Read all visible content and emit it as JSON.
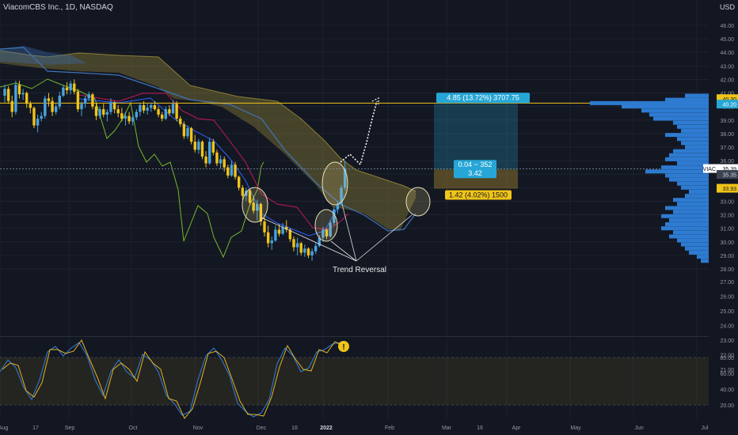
{
  "header": {
    "title": "ViacomCBS Inc., 1D, NASDAQ",
    "currency": "USD"
  },
  "chart_data": {
    "type": "candlestick",
    "price_axis": {
      "ticks": [
        28.0,
        29.0,
        30.0,
        31.0,
        32.0,
        33.0,
        34.0,
        35.0,
        36.0,
        37.0,
        38.0,
        39.0,
        40.0,
        41.0,
        42.0,
        43.0,
        44.0,
        45.0,
        46.0
      ],
      "min": 27.5,
      "max": 46.5
    },
    "extended_ticks": [
      "27.00",
      "26.00",
      "25.00",
      "24.00",
      "23.00",
      "22.00",
      "21.00"
    ],
    "oscillator_axis": {
      "ticks": [
        "20.00",
        "40.00",
        "60.00",
        "80.00"
      ],
      "band": [
        20,
        80
      ]
    },
    "time_axis": [
      "Aug",
      "17",
      "Sep",
      "Oct",
      "Nov",
      "Dec",
      "16",
      "2022",
      "Feb",
      "Mar",
      "16",
      "Apr",
      "May",
      "Jun",
      "Jul"
    ],
    "price_labels": {
      "last": "35.39",
      "symbol": "VIAC",
      "level_top_a": "40.30",
      "level_top_b": "40.20",
      "level_mid": "35.35",
      "level_stop": "33.93"
    },
    "position_tool": {
      "target_label": "4.85 (13.72%) 3707.75",
      "center_line1": "0.04 ~ 352",
      "center_line2": "3.42",
      "stop_label": "1.42 (4.02%) 1500",
      "entry": 35.35,
      "target": 40.2,
      "stop": 33.93
    },
    "annotation": "Trend Reversal",
    "alert_icon": "!",
    "volume_profile": [
      {
        "p": 40.8,
        "w": 30
      },
      {
        "p": 40.5,
        "w": 55
      },
      {
        "p": 40.25,
        "w": 150
      },
      {
        "p": 40.0,
        "w": 110
      },
      {
        "p": 39.7,
        "w": 85
      },
      {
        "p": 39.4,
        "w": 75
      },
      {
        "p": 39.1,
        "w": 70
      },
      {
        "p": 38.8,
        "w": 45
      },
      {
        "p": 38.5,
        "w": 40
      },
      {
        "p": 38.2,
        "w": 35
      },
      {
        "p": 37.9,
        "w": 55
      },
      {
        "p": 37.6,
        "w": 40
      },
      {
        "p": 37.3,
        "w": 35
      },
      {
        "p": 37.0,
        "w": 30
      },
      {
        "p": 36.7,
        "w": 45
      },
      {
        "p": 36.4,
        "w": 50
      },
      {
        "p": 36.1,
        "w": 55
      },
      {
        "p": 35.8,
        "w": 40
      },
      {
        "p": 35.5,
        "w": 60
      },
      {
        "p": 35.2,
        "w": 80
      },
      {
        "p": 34.9,
        "w": 55
      },
      {
        "p": 34.6,
        "w": 50
      },
      {
        "p": 34.3,
        "w": 40
      },
      {
        "p": 34.0,
        "w": 35
      },
      {
        "p": 33.7,
        "w": 25
      },
      {
        "p": 33.4,
        "w": 30
      },
      {
        "p": 33.1,
        "w": 45
      },
      {
        "p": 32.8,
        "w": 40
      },
      {
        "p": 32.5,
        "w": 55
      },
      {
        "p": 32.2,
        "w": 45
      },
      {
        "p": 31.9,
        "w": 60
      },
      {
        "p": 31.6,
        "w": 50
      },
      {
        "p": 31.3,
        "w": 55
      },
      {
        "p": 31.0,
        "w": 60
      },
      {
        "p": 30.7,
        "w": 45
      },
      {
        "p": 30.4,
        "w": 50
      },
      {
        "p": 30.1,
        "w": 40
      },
      {
        "p": 29.8,
        "w": 35
      },
      {
        "p": 29.5,
        "w": 30
      },
      {
        "p": 29.2,
        "w": 25
      },
      {
        "p": 28.9,
        "w": 15
      },
      {
        "p": 28.6,
        "w": 10
      }
    ],
    "candles": [
      [
        40.8,
        41.6,
        40.3,
        41.3
      ],
      [
        41.3,
        41.5,
        40.2,
        40.4
      ],
      [
        40.4,
        40.8,
        39.2,
        39.6
      ],
      [
        39.6,
        41.9,
        39.4,
        41.6
      ],
      [
        41.6,
        41.9,
        40.6,
        40.9
      ],
      [
        40.9,
        41.3,
        40.5,
        41.0
      ],
      [
        41.0,
        41.1,
        39.9,
        40.2
      ],
      [
        40.2,
        40.4,
        39.5,
        39.9
      ],
      [
        39.9,
        40.0,
        38.4,
        38.6
      ],
      [
        38.6,
        39.4,
        38.1,
        39.1
      ],
      [
        39.1,
        39.6,
        38.9,
        39.3
      ],
      [
        39.3,
        40.8,
        39.1,
        40.6
      ],
      [
        40.6,
        41.0,
        40.0,
        40.4
      ],
      [
        40.4,
        40.7,
        39.3,
        39.6
      ],
      [
        39.6,
        40.2,
        39.4,
        40.0
      ],
      [
        40.0,
        41.1,
        39.8,
        40.8
      ],
      [
        40.8,
        41.6,
        40.7,
        41.4
      ],
      [
        41.4,
        41.8,
        40.9,
        41.2
      ],
      [
        41.2,
        41.9,
        40.9,
        41.7
      ],
      [
        41.7,
        42.0,
        40.9,
        41.1
      ],
      [
        41.1,
        41.3,
        39.6,
        39.8
      ],
      [
        39.8,
        40.4,
        39.3,
        40.2
      ],
      [
        40.2,
        40.8,
        39.9,
        40.6
      ],
      [
        40.6,
        41.1,
        40.4,
        40.9
      ],
      [
        40.9,
        41.0,
        39.8,
        40.0
      ],
      [
        40.0,
        40.3,
        39.0,
        39.3
      ],
      [
        39.3,
        40.0,
        39.1,
        39.8
      ],
      [
        39.8,
        40.2,
        39.2,
        39.4
      ],
      [
        39.4,
        39.8,
        38.9,
        39.6
      ],
      [
        39.6,
        40.6,
        39.4,
        40.3
      ],
      [
        40.3,
        40.4,
        39.5,
        39.8
      ],
      [
        39.8,
        40.1,
        39.2,
        39.5
      ],
      [
        39.5,
        39.9,
        38.9,
        39.1
      ],
      [
        39.1,
        39.6,
        38.6,
        39.3
      ],
      [
        39.3,
        39.6,
        38.7,
        38.9
      ],
      [
        38.9,
        39.4,
        38.6,
        39.2
      ],
      [
        39.2,
        39.8,
        39.0,
        39.6
      ],
      [
        39.6,
        40.3,
        39.3,
        40.1
      ],
      [
        40.1,
        40.4,
        39.5,
        39.7
      ],
      [
        39.7,
        40.2,
        39.4,
        39.9
      ],
      [
        39.9,
        40.3,
        39.6,
        40.1
      ],
      [
        40.1,
        40.4,
        39.7,
        39.8
      ],
      [
        39.8,
        40.0,
        39.2,
        39.4
      ],
      [
        39.4,
        39.6,
        38.9,
        39.1
      ],
      [
        39.1,
        40.0,
        39.0,
        39.8
      ],
      [
        39.8,
        40.1,
        39.3,
        39.5
      ],
      [
        39.5,
        40.5,
        39.4,
        40.2
      ],
      [
        40.2,
        40.4,
        38.9,
        39.1
      ],
      [
        39.1,
        39.3,
        38.5,
        38.7
      ],
      [
        38.7,
        38.9,
        37.6,
        37.8
      ],
      [
        37.8,
        38.6,
        37.6,
        38.4
      ],
      [
        38.4,
        38.5,
        37.2,
        37.4
      ],
      [
        37.4,
        37.9,
        36.6,
        36.8
      ],
      [
        36.8,
        37.6,
        36.5,
        37.4
      ],
      [
        37.4,
        37.5,
        36.1,
        36.3
      ],
      [
        36.3,
        36.7,
        35.5,
        35.8
      ],
      [
        35.8,
        37.7,
        35.7,
        37.4
      ],
      [
        37.4,
        37.6,
        36.4,
        36.6
      ],
      [
        36.6,
        36.8,
        35.6,
        35.8
      ],
      [
        35.8,
        36.4,
        35.4,
        36.1
      ],
      [
        36.1,
        36.3,
        35.2,
        35.5
      ],
      [
        35.5,
        35.7,
        34.7,
        34.9
      ],
      [
        34.9,
        36.0,
        34.8,
        35.7
      ],
      [
        35.7,
        35.9,
        34.6,
        34.8
      ],
      [
        34.8,
        34.9,
        33.8,
        34.0
      ],
      [
        34.0,
        34.2,
        33.1,
        33.4
      ],
      [
        33.4,
        34.0,
        33.0,
        33.8
      ],
      [
        33.8,
        33.9,
        32.7,
        32.9
      ],
      [
        32.9,
        33.4,
        32.1,
        32.3
      ],
      [
        32.3,
        33.1,
        31.6,
        32.8
      ],
      [
        32.8,
        32.9,
        31.2,
        31.5
      ],
      [
        31.5,
        31.8,
        30.4,
        30.7
      ],
      [
        30.7,
        31.2,
        29.6,
        29.9
      ],
      [
        29.9,
        30.4,
        29.4,
        30.1
      ],
      [
        30.1,
        31.2,
        30.0,
        30.9
      ],
      [
        30.9,
        31.3,
        30.4,
        30.6
      ],
      [
        30.6,
        31.4,
        30.5,
        31.1
      ],
      [
        31.1,
        31.6,
        30.7,
        30.9
      ],
      [
        30.9,
        31.0,
        30.0,
        30.2
      ],
      [
        30.2,
        30.4,
        29.3,
        29.6
      ],
      [
        29.6,
        30.3,
        29.0,
        29.9
      ],
      [
        29.9,
        30.0,
        29.0,
        29.2
      ],
      [
        29.2,
        29.8,
        28.9,
        29.5
      ],
      [
        29.5,
        29.6,
        28.8,
        29.0
      ],
      [
        29.0,
        29.5,
        28.6,
        29.3
      ],
      [
        29.3,
        29.9,
        29.1,
        29.7
      ],
      [
        29.7,
        30.5,
        29.6,
        30.3
      ],
      [
        30.3,
        31.1,
        30.0,
        30.9
      ],
      [
        30.9,
        31.0,
        30.2,
        30.4
      ],
      [
        30.4,
        31.6,
        30.3,
        31.4
      ],
      [
        31.4,
        32.6,
        31.2,
        32.4
      ],
      [
        32.4,
        33.0,
        32.1,
        32.8
      ],
      [
        32.8,
        34.2,
        32.7,
        34.0
      ],
      [
        34.0,
        36.0,
        33.8,
        35.39
      ]
    ]
  }
}
